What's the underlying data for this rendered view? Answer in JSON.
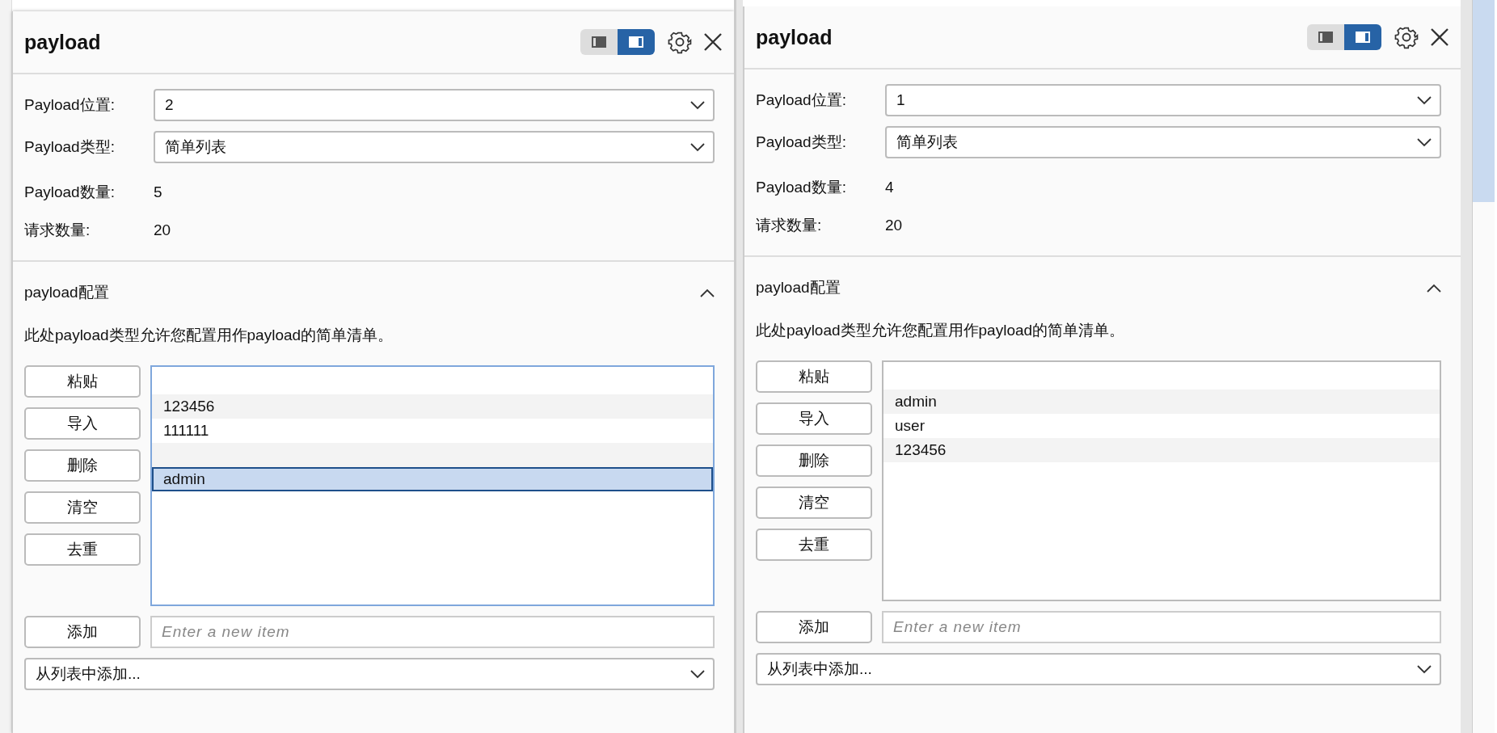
{
  "panels": [
    {
      "title": "payload",
      "view_toggle": [
        {
          "selected": false
        },
        {
          "selected": true
        }
      ],
      "position_label": "Payload位置:",
      "position_value": "2",
      "type_label": "Payload类型:",
      "type_value": "简单列表",
      "count_label": "Payload数量:",
      "count_value": "5",
      "requests_label": "请求数量:",
      "requests_value": "20",
      "section_title": "payload配置",
      "expanded": true,
      "description": "此处payload类型允许您配置用作payload的简单清单。",
      "list_focused": true,
      "buttons": [
        "粘贴",
        "导入",
        "删除",
        "清空",
        "去重"
      ],
      "items": [
        {
          "kind": "blank",
          "selected": false
        },
        {
          "kind": "text",
          "text": "123456",
          "selected": false
        },
        {
          "kind": "text",
          "text": "111111",
          "selected": false
        },
        {
          "kind": "blank",
          "selected": false
        },
        {
          "kind": "text",
          "text": "admin",
          "selected": true
        }
      ],
      "add_button": "添加",
      "new_item_placeholder": "Enter a new item",
      "add_from_list": "从列表中添加..."
    },
    {
      "title": "payload",
      "view_toggle": [
        {
          "selected": false
        },
        {
          "selected": true
        }
      ],
      "position_label": "Payload位置:",
      "position_value": "1",
      "type_label": "Payload类型:",
      "type_value": "简单列表",
      "count_label": "Payload数量:",
      "count_value": "4",
      "requests_label": "请求数量:",
      "requests_value": "20",
      "section_title": "payload配置",
      "expanded": true,
      "description": "此处payload类型允许您配置用作payload的简单清单。",
      "list_focused": false,
      "buttons": [
        "粘贴",
        "导入",
        "删除",
        "清空",
        "去重"
      ],
      "items": [
        {
          "kind": "blank",
          "selected": false
        },
        {
          "kind": "text",
          "text": "admin",
          "selected": false
        },
        {
          "kind": "text",
          "text": "user",
          "selected": false
        },
        {
          "kind": "text",
          "text": "123456",
          "selected": false
        }
      ],
      "add_button": "添加",
      "new_item_placeholder": "Enter a new item",
      "add_from_list": "从列表中添加..."
    }
  ]
}
